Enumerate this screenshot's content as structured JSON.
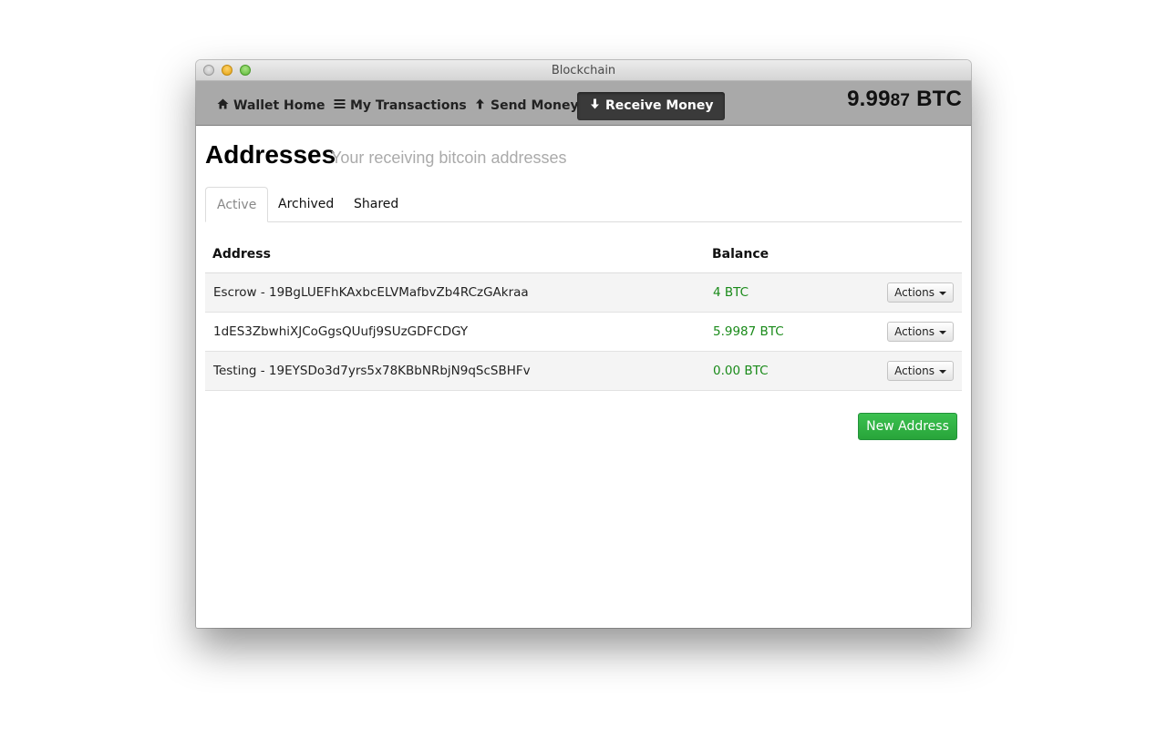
{
  "window": {
    "title": "Blockchain"
  },
  "navbar": {
    "items": [
      {
        "label": "Wallet Home",
        "icon": "home-icon"
      },
      {
        "label": "My Transactions",
        "icon": "list-icon"
      },
      {
        "label": "Send Money",
        "icon": "arrow-up-icon"
      },
      {
        "label": "Receive Money",
        "icon": "arrow-down-icon",
        "active": true
      }
    ],
    "balance_main": "9.99",
    "balance_small": "87",
    "balance_unit": "BTC"
  },
  "page": {
    "title": "Addresses",
    "subtitle": "Your receiving bitcoin addresses"
  },
  "tabs": [
    {
      "label": "Active",
      "active": true
    },
    {
      "label": "Archived"
    },
    {
      "label": "Shared"
    }
  ],
  "table": {
    "headers": {
      "address": "Address",
      "balance": "Balance"
    },
    "rows": [
      {
        "address": "Escrow - 19BgLUEFhKAxbcELVMafbvZb4RCzGAkraa",
        "balance": "4 BTC",
        "action": "Actions"
      },
      {
        "address": "1dES3ZbwhiXJCoGgsQUufj9SUzGDFCDGY",
        "balance": "5.9987 BTC",
        "action": "Actions"
      },
      {
        "address": "Testing - 19EYSDo3d7yrs5x78KBbNRbjN9qScSBHFv",
        "balance": "0.00 BTC",
        "action": "Actions"
      }
    ]
  },
  "buttons": {
    "new_address": "New Address"
  },
  "colors": {
    "navbar_bg": "#a9a9a9",
    "active_nav": "#3a3a3a",
    "balance_green": "#198a19",
    "primary_green": "#2db844"
  }
}
